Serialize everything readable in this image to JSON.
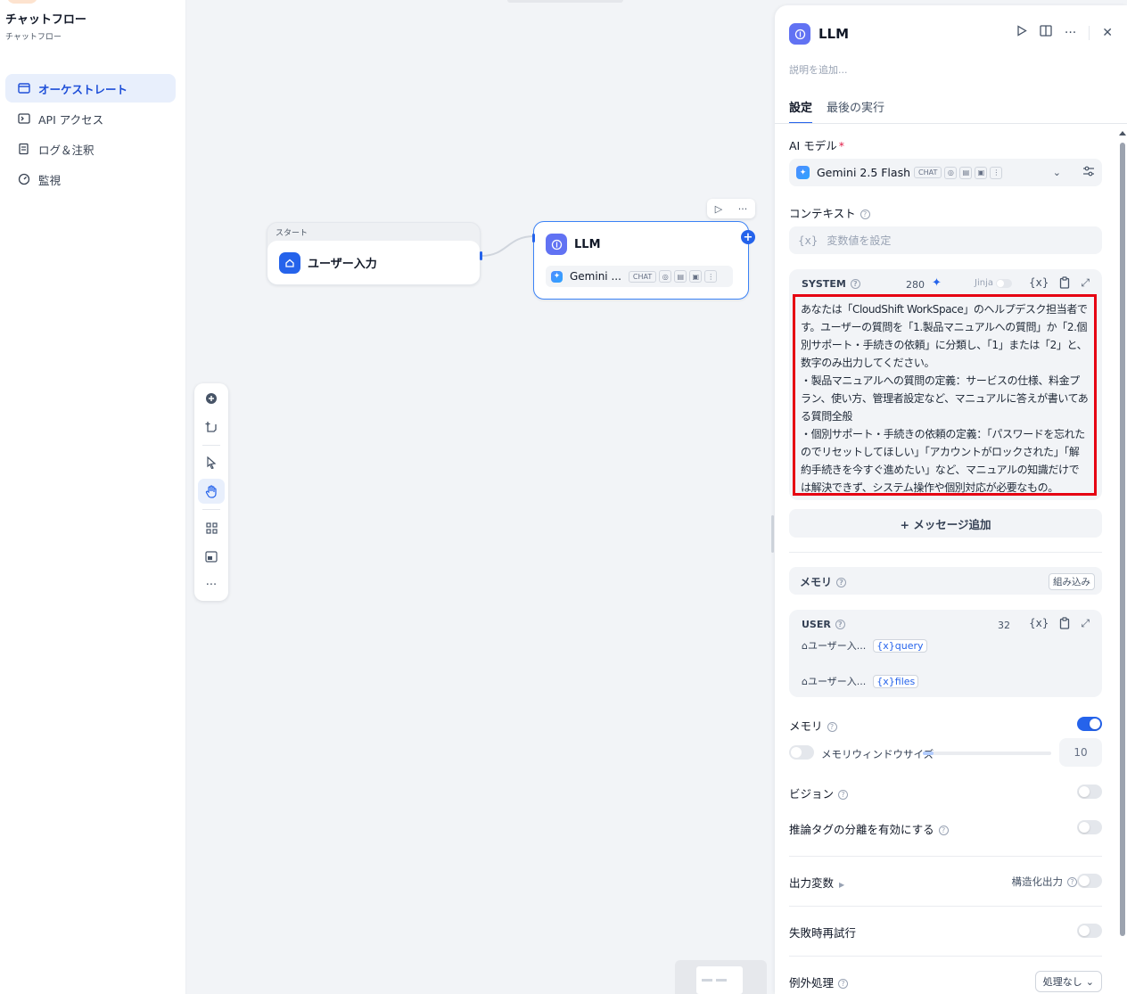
{
  "app": {
    "title": "チャットフロー",
    "subtitle": "チャットフロー"
  },
  "sidebar": {
    "items": [
      {
        "label": "オーケストレート",
        "icon": "layout-icon",
        "active": true
      },
      {
        "label": "API アクセス",
        "icon": "terminal-icon",
        "active": false
      },
      {
        "label": "ログ＆注釈",
        "icon": "log-icon",
        "active": false
      },
      {
        "label": "監視",
        "icon": "gauge-icon",
        "active": false
      }
    ]
  },
  "canvas": {
    "start_node": {
      "header": "スタート",
      "title": "ユーザー入力"
    },
    "llm_node": {
      "title": "LLM",
      "model": "Gemini ...",
      "badge": "CHAT"
    },
    "toolbar": {
      "run": "▷",
      "more": "···"
    }
  },
  "panel": {
    "title": "LLM",
    "description_placeholder": "説明を追加...",
    "tabs": [
      "設定",
      "最後の実行"
    ],
    "model_label": "AI モデル",
    "model_name": "Gemini 2.5 Flash",
    "model_badge": "CHAT",
    "context_label": "コンテキスト",
    "context_placeholder": "変数値を設定",
    "system": {
      "label": "SYSTEM",
      "count": "280",
      "jinja": "Jinja",
      "text": "あなたは「CloudShift WorkSpace」のヘルプデスク担当者です。ユーザーの質問を「1.製品マニュアルへの質問」か「2.個別サポート・手続きの依頼」に分類し、「1」または「2」と、数字のみ出力してください。\n・製品マニュアルへの質問の定義：サービスの仕様、料金プラン、使い方、管理者設定など、マニュアルに答えが書いてある質問全般\n・個別サポート・手続きの依頼の定義：「パスワードを忘れたのでリセットしてほしい」「アカウントがロックされた」「解約手続きを今すぐ進めたい」など、マニュアルの知識だけでは解決できず、システム操作や個別対応が必要なもの。"
    },
    "add_message": "+ メッセージ追加",
    "memory_box": {
      "label": "メモリ",
      "builtin": "組み込み"
    },
    "user": {
      "label": "USER",
      "count": "32",
      "vars": [
        {
          "source": "ユーザー入...",
          "var": "query"
        },
        {
          "source": "ユーザー入...",
          "var": "files"
        }
      ]
    },
    "memory_label": "メモリ",
    "memory_enabled": true,
    "memory_window_label": "メモリウィンドウサイズ",
    "memory_window_value": "10",
    "vision_label": "ビジョン",
    "reasoning_label": "推論タグの分離を有効にする",
    "output_label": "出力変数",
    "structured_output_label": "構造化出力",
    "retry_label": "失敗時再試行",
    "exception_label": "例外処理",
    "exception_value": "処理なし"
  }
}
